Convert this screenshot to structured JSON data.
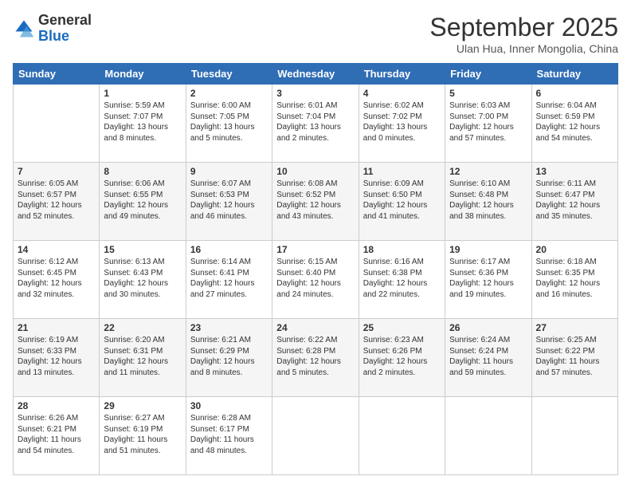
{
  "logo": {
    "general": "General",
    "blue": "Blue"
  },
  "title": "September 2025",
  "location": "Ulan Hua, Inner Mongolia, China",
  "days_of_week": [
    "Sunday",
    "Monday",
    "Tuesday",
    "Wednesday",
    "Thursday",
    "Friday",
    "Saturday"
  ],
  "weeks": [
    [
      {
        "day": "",
        "lines": []
      },
      {
        "day": "1",
        "lines": [
          "Sunrise: 5:59 AM",
          "Sunset: 7:07 PM",
          "Daylight: 13 hours",
          "and 8 minutes."
        ]
      },
      {
        "day": "2",
        "lines": [
          "Sunrise: 6:00 AM",
          "Sunset: 7:05 PM",
          "Daylight: 13 hours",
          "and 5 minutes."
        ]
      },
      {
        "day": "3",
        "lines": [
          "Sunrise: 6:01 AM",
          "Sunset: 7:04 PM",
          "Daylight: 13 hours",
          "and 2 minutes."
        ]
      },
      {
        "day": "4",
        "lines": [
          "Sunrise: 6:02 AM",
          "Sunset: 7:02 PM",
          "Daylight: 13 hours",
          "and 0 minutes."
        ]
      },
      {
        "day": "5",
        "lines": [
          "Sunrise: 6:03 AM",
          "Sunset: 7:00 PM",
          "Daylight: 12 hours",
          "and 57 minutes."
        ]
      },
      {
        "day": "6",
        "lines": [
          "Sunrise: 6:04 AM",
          "Sunset: 6:59 PM",
          "Daylight: 12 hours",
          "and 54 minutes."
        ]
      }
    ],
    [
      {
        "day": "7",
        "lines": [
          "Sunrise: 6:05 AM",
          "Sunset: 6:57 PM",
          "Daylight: 12 hours",
          "and 52 minutes."
        ]
      },
      {
        "day": "8",
        "lines": [
          "Sunrise: 6:06 AM",
          "Sunset: 6:55 PM",
          "Daylight: 12 hours",
          "and 49 minutes."
        ]
      },
      {
        "day": "9",
        "lines": [
          "Sunrise: 6:07 AM",
          "Sunset: 6:53 PM",
          "Daylight: 12 hours",
          "and 46 minutes."
        ]
      },
      {
        "day": "10",
        "lines": [
          "Sunrise: 6:08 AM",
          "Sunset: 6:52 PM",
          "Daylight: 12 hours",
          "and 43 minutes."
        ]
      },
      {
        "day": "11",
        "lines": [
          "Sunrise: 6:09 AM",
          "Sunset: 6:50 PM",
          "Daylight: 12 hours",
          "and 41 minutes."
        ]
      },
      {
        "day": "12",
        "lines": [
          "Sunrise: 6:10 AM",
          "Sunset: 6:48 PM",
          "Daylight: 12 hours",
          "and 38 minutes."
        ]
      },
      {
        "day": "13",
        "lines": [
          "Sunrise: 6:11 AM",
          "Sunset: 6:47 PM",
          "Daylight: 12 hours",
          "and 35 minutes."
        ]
      }
    ],
    [
      {
        "day": "14",
        "lines": [
          "Sunrise: 6:12 AM",
          "Sunset: 6:45 PM",
          "Daylight: 12 hours",
          "and 32 minutes."
        ]
      },
      {
        "day": "15",
        "lines": [
          "Sunrise: 6:13 AM",
          "Sunset: 6:43 PM",
          "Daylight: 12 hours",
          "and 30 minutes."
        ]
      },
      {
        "day": "16",
        "lines": [
          "Sunrise: 6:14 AM",
          "Sunset: 6:41 PM",
          "Daylight: 12 hours",
          "and 27 minutes."
        ]
      },
      {
        "day": "17",
        "lines": [
          "Sunrise: 6:15 AM",
          "Sunset: 6:40 PM",
          "Daylight: 12 hours",
          "and 24 minutes."
        ]
      },
      {
        "day": "18",
        "lines": [
          "Sunrise: 6:16 AM",
          "Sunset: 6:38 PM",
          "Daylight: 12 hours",
          "and 22 minutes."
        ]
      },
      {
        "day": "19",
        "lines": [
          "Sunrise: 6:17 AM",
          "Sunset: 6:36 PM",
          "Daylight: 12 hours",
          "and 19 minutes."
        ]
      },
      {
        "day": "20",
        "lines": [
          "Sunrise: 6:18 AM",
          "Sunset: 6:35 PM",
          "Daylight: 12 hours",
          "and 16 minutes."
        ]
      }
    ],
    [
      {
        "day": "21",
        "lines": [
          "Sunrise: 6:19 AM",
          "Sunset: 6:33 PM",
          "Daylight: 12 hours",
          "and 13 minutes."
        ]
      },
      {
        "day": "22",
        "lines": [
          "Sunrise: 6:20 AM",
          "Sunset: 6:31 PM",
          "Daylight: 12 hours",
          "and 11 minutes."
        ]
      },
      {
        "day": "23",
        "lines": [
          "Sunrise: 6:21 AM",
          "Sunset: 6:29 PM",
          "Daylight: 12 hours",
          "and 8 minutes."
        ]
      },
      {
        "day": "24",
        "lines": [
          "Sunrise: 6:22 AM",
          "Sunset: 6:28 PM",
          "Daylight: 12 hours",
          "and 5 minutes."
        ]
      },
      {
        "day": "25",
        "lines": [
          "Sunrise: 6:23 AM",
          "Sunset: 6:26 PM",
          "Daylight: 12 hours",
          "and 2 minutes."
        ]
      },
      {
        "day": "26",
        "lines": [
          "Sunrise: 6:24 AM",
          "Sunset: 6:24 PM",
          "Daylight: 11 hours",
          "and 59 minutes."
        ]
      },
      {
        "day": "27",
        "lines": [
          "Sunrise: 6:25 AM",
          "Sunset: 6:22 PM",
          "Daylight: 11 hours",
          "and 57 minutes."
        ]
      }
    ],
    [
      {
        "day": "28",
        "lines": [
          "Sunrise: 6:26 AM",
          "Sunset: 6:21 PM",
          "Daylight: 11 hours",
          "and 54 minutes."
        ]
      },
      {
        "day": "29",
        "lines": [
          "Sunrise: 6:27 AM",
          "Sunset: 6:19 PM",
          "Daylight: 11 hours",
          "and 51 minutes."
        ]
      },
      {
        "day": "30",
        "lines": [
          "Sunrise: 6:28 AM",
          "Sunset: 6:17 PM",
          "Daylight: 11 hours",
          "and 48 minutes."
        ]
      },
      {
        "day": "",
        "lines": []
      },
      {
        "day": "",
        "lines": []
      },
      {
        "day": "",
        "lines": []
      },
      {
        "day": "",
        "lines": []
      }
    ]
  ]
}
